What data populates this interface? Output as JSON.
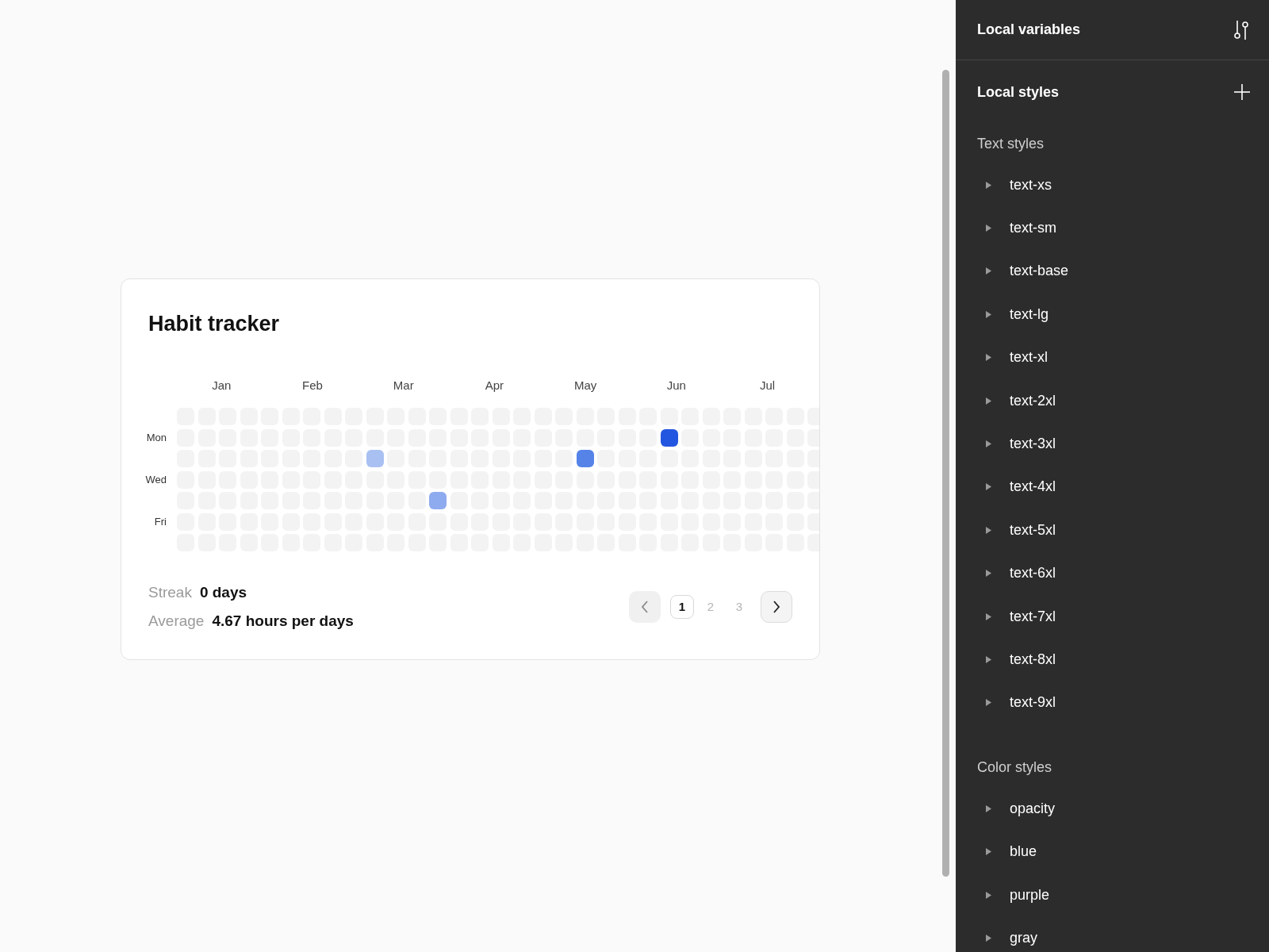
{
  "card": {
    "title": "Habit tracker",
    "months": [
      "Jan",
      "Feb",
      "Mar",
      "Apr",
      "May",
      "Jun",
      "Jul"
    ],
    "rows": [
      {
        "cells": [
          {
            "color": "#f3f3f3"
          },
          {
            "color": "#f3f3f3"
          },
          {
            "color": "#f3f3f3"
          },
          {
            "color": "#f3f3f3"
          },
          {
            "color": "#f3f3f3"
          },
          {
            "color": "#f3f3f3"
          },
          {
            "color": "#f3f3f3"
          },
          {
            "color": "#f3f3f3"
          },
          {
            "color": "#f3f3f3"
          },
          {
            "color": "#f3f3f3"
          },
          {
            "color": "#f3f3f3"
          },
          {
            "color": "#f3f3f3"
          },
          {
            "color": "#f3f3f3"
          },
          {
            "color": "#f3f3f3"
          },
          {
            "color": "#f3f3f3"
          },
          {
            "color": "#f3f3f3"
          },
          {
            "color": "#f3f3f3"
          },
          {
            "color": "#f3f3f3"
          },
          {
            "color": "#f3f3f3"
          },
          {
            "color": "#f3f3f3"
          },
          {
            "color": "#f3f3f3"
          },
          {
            "color": "#f3f3f3"
          },
          {
            "color": "#f3f3f3"
          },
          {
            "color": "#f3f3f3"
          },
          {
            "color": "#f3f3f3"
          },
          {
            "color": "#f3f3f3"
          },
          {
            "color": "#f3f3f3"
          },
          {
            "color": "#f3f3f3"
          },
          {
            "color": "#f3f3f3"
          },
          {
            "color": "#f3f3f3"
          },
          {
            "color": "#f3f3f3"
          }
        ]
      },
      {
        "label": "Mon",
        "cells": [
          {
            "color": "#f3f3f3"
          },
          {
            "color": "#f3f3f3"
          },
          {
            "color": "#f3f3f3"
          },
          {
            "color": "#f3f3f3"
          },
          {
            "color": "#f3f3f3"
          },
          {
            "color": "#f3f3f3"
          },
          {
            "color": "#f3f3f3"
          },
          {
            "color": "#f3f3f3"
          },
          {
            "color": "#f3f3f3"
          },
          {
            "color": "#f3f3f3"
          },
          {
            "color": "#f3f3f3"
          },
          {
            "color": "#f3f3f3"
          },
          {
            "color": "#f3f3f3"
          },
          {
            "color": "#f3f3f3"
          },
          {
            "color": "#f3f3f3"
          },
          {
            "color": "#f3f3f3"
          },
          {
            "color": "#f3f3f3"
          },
          {
            "color": "#f3f3f3"
          },
          {
            "color": "#f3f3f3"
          },
          {
            "color": "#f3f3f3"
          },
          {
            "color": "#f3f3f3"
          },
          {
            "color": "#f3f3f3"
          },
          {
            "color": "#f3f3f3"
          },
          {
            "color": "#2356e0"
          },
          {
            "color": "#f3f3f3"
          },
          {
            "color": "#f3f3f3"
          },
          {
            "color": "#f3f3f3"
          },
          {
            "color": "#f3f3f3"
          },
          {
            "color": "#f3f3f3"
          },
          {
            "color": "#f3f3f3"
          },
          {
            "color": "#f3f3f3"
          }
        ]
      },
      {
        "cells": [
          {
            "color": "#f3f3f3"
          },
          {
            "color": "#f3f3f3"
          },
          {
            "color": "#f3f3f3"
          },
          {
            "color": "#f3f3f3"
          },
          {
            "color": "#f3f3f3"
          },
          {
            "color": "#f3f3f3"
          },
          {
            "color": "#f3f3f3"
          },
          {
            "color": "#f3f3f3"
          },
          {
            "color": "#f3f3f3"
          },
          {
            "color": "#a9c0f2"
          },
          {
            "color": "#f3f3f3"
          },
          {
            "color": "#f3f3f3"
          },
          {
            "color": "#f3f3f3"
          },
          {
            "color": "#f3f3f3"
          },
          {
            "color": "#f3f3f3"
          },
          {
            "color": "#f3f3f3"
          },
          {
            "color": "#f3f3f3"
          },
          {
            "color": "#f3f3f3"
          },
          {
            "color": "#f3f3f3"
          },
          {
            "color": "#5583e8"
          },
          {
            "color": "#f3f3f3"
          },
          {
            "color": "#f3f3f3"
          },
          {
            "color": "#f3f3f3"
          },
          {
            "color": "#f3f3f3"
          },
          {
            "color": "#f3f3f3"
          },
          {
            "color": "#f3f3f3"
          },
          {
            "color": "#f3f3f3"
          },
          {
            "color": "#f3f3f3"
          },
          {
            "color": "#f3f3f3"
          },
          {
            "color": "#f3f3f3"
          },
          {
            "color": "#f3f3f3"
          }
        ]
      },
      {
        "label": "Wed",
        "cells": [
          {
            "color": "#f3f3f3"
          },
          {
            "color": "#f3f3f3"
          },
          {
            "color": "#f3f3f3"
          },
          {
            "color": "#f3f3f3"
          },
          {
            "color": "#f3f3f3"
          },
          {
            "color": "#f3f3f3"
          },
          {
            "color": "#f3f3f3"
          },
          {
            "color": "#f3f3f3"
          },
          {
            "color": "#f3f3f3"
          },
          {
            "color": "#f3f3f3"
          },
          {
            "color": "#f3f3f3"
          },
          {
            "color": "#f3f3f3"
          },
          {
            "color": "#f3f3f3"
          },
          {
            "color": "#f3f3f3"
          },
          {
            "color": "#f3f3f3"
          },
          {
            "color": "#f3f3f3"
          },
          {
            "color": "#f3f3f3"
          },
          {
            "color": "#f3f3f3"
          },
          {
            "color": "#f3f3f3"
          },
          {
            "color": "#f3f3f3"
          },
          {
            "color": "#f3f3f3"
          },
          {
            "color": "#f3f3f3"
          },
          {
            "color": "#f3f3f3"
          },
          {
            "color": "#f3f3f3"
          },
          {
            "color": "#f3f3f3"
          },
          {
            "color": "#f3f3f3"
          },
          {
            "color": "#f3f3f3"
          },
          {
            "color": "#f3f3f3"
          },
          {
            "color": "#f3f3f3"
          },
          {
            "color": "#f3f3f3"
          },
          {
            "color": "#f3f3f3"
          }
        ]
      },
      {
        "cells": [
          {
            "color": "#f3f3f3"
          },
          {
            "color": "#f3f3f3"
          },
          {
            "color": "#f3f3f3"
          },
          {
            "color": "#f3f3f3"
          },
          {
            "color": "#f3f3f3"
          },
          {
            "color": "#f3f3f3"
          },
          {
            "color": "#f3f3f3"
          },
          {
            "color": "#f3f3f3"
          },
          {
            "color": "#f3f3f3"
          },
          {
            "color": "#f3f3f3"
          },
          {
            "color": "#f3f3f3"
          },
          {
            "color": "#f3f3f3"
          },
          {
            "color": "#8fabef"
          },
          {
            "color": "#f3f3f3"
          },
          {
            "color": "#f3f3f3"
          },
          {
            "color": "#f3f3f3"
          },
          {
            "color": "#f3f3f3"
          },
          {
            "color": "#f3f3f3"
          },
          {
            "color": "#f3f3f3"
          },
          {
            "color": "#f3f3f3"
          },
          {
            "color": "#f3f3f3"
          },
          {
            "color": "#f3f3f3"
          },
          {
            "color": "#f3f3f3"
          },
          {
            "color": "#f3f3f3"
          },
          {
            "color": "#f3f3f3"
          },
          {
            "color": "#f3f3f3"
          },
          {
            "color": "#f3f3f3"
          },
          {
            "color": "#f3f3f3"
          },
          {
            "color": "#f3f3f3"
          },
          {
            "color": "#f3f3f3"
          },
          {
            "color": "#f3f3f3"
          }
        ]
      },
      {
        "label": "Fri",
        "cells": [
          {
            "color": "#f3f3f3"
          },
          {
            "color": "#f3f3f3"
          },
          {
            "color": "#f3f3f3"
          },
          {
            "color": "#f3f3f3"
          },
          {
            "color": "#f3f3f3"
          },
          {
            "color": "#f3f3f3"
          },
          {
            "color": "#f3f3f3"
          },
          {
            "color": "#f3f3f3"
          },
          {
            "color": "#f3f3f3"
          },
          {
            "color": "#f3f3f3"
          },
          {
            "color": "#f3f3f3"
          },
          {
            "color": "#f3f3f3"
          },
          {
            "color": "#f3f3f3"
          },
          {
            "color": "#f3f3f3"
          },
          {
            "color": "#f3f3f3"
          },
          {
            "color": "#f3f3f3"
          },
          {
            "color": "#f3f3f3"
          },
          {
            "color": "#f3f3f3"
          },
          {
            "color": "#f3f3f3"
          },
          {
            "color": "#f3f3f3"
          },
          {
            "color": "#f3f3f3"
          },
          {
            "color": "#f3f3f3"
          },
          {
            "color": "#f3f3f3"
          },
          {
            "color": "#f3f3f3"
          },
          {
            "color": "#f3f3f3"
          },
          {
            "color": "#f3f3f3"
          },
          {
            "color": "#f3f3f3"
          },
          {
            "color": "#f3f3f3"
          },
          {
            "color": "#f3f3f3"
          },
          {
            "color": "#f3f3f3"
          },
          {
            "color": "#f3f3f3"
          }
        ]
      },
      {
        "cells": [
          {
            "color": "#f3f3f3"
          },
          {
            "color": "#f3f3f3"
          },
          {
            "color": "#f3f3f3"
          },
          {
            "color": "#f3f3f3"
          },
          {
            "color": "#f3f3f3"
          },
          {
            "color": "#f3f3f3"
          },
          {
            "color": "#f3f3f3"
          },
          {
            "color": "#f3f3f3"
          },
          {
            "color": "#f3f3f3"
          },
          {
            "color": "#f3f3f3"
          },
          {
            "color": "#f3f3f3"
          },
          {
            "color": "#f3f3f3"
          },
          {
            "color": "#f3f3f3"
          },
          {
            "color": "#f3f3f3"
          },
          {
            "color": "#f3f3f3"
          },
          {
            "color": "#f3f3f3"
          },
          {
            "color": "#f3f3f3"
          },
          {
            "color": "#f3f3f3"
          },
          {
            "color": "#f3f3f3"
          },
          {
            "color": "#f3f3f3"
          },
          {
            "color": "#f3f3f3"
          },
          {
            "color": "#f3f3f3"
          },
          {
            "color": "#f3f3f3"
          },
          {
            "color": "#f3f3f3"
          },
          {
            "color": "#f3f3f3"
          },
          {
            "color": "#f3f3f3"
          },
          {
            "color": "#f3f3f3"
          },
          {
            "color": "#f3f3f3"
          },
          {
            "color": "#f3f3f3"
          },
          {
            "color": "#f3f3f3"
          },
          {
            "color": "#f3f3f3"
          }
        ]
      }
    ],
    "stats": [
      {
        "label": "Streak",
        "value": "0 days"
      },
      {
        "label": "Average",
        "value": "4.67 hours per days"
      }
    ],
    "pagination": {
      "prev": {
        "disabled": true
      },
      "next": {
        "disabled": false
      },
      "pages": [
        {
          "label": "1",
          "selected": true
        },
        {
          "label": "2",
          "selected": false
        },
        {
          "label": "3",
          "selected": false
        }
      ]
    }
  },
  "panel": {
    "variables_title": "Local variables",
    "styles_title": "Local styles",
    "groups": [
      {
        "title": "Text styles",
        "items": [
          {
            "label": "text-xs",
            "expanded": false
          },
          {
            "label": "text-sm",
            "expanded": false
          },
          {
            "label": "text-base",
            "expanded": false
          },
          {
            "label": "text-lg",
            "expanded": false
          },
          {
            "label": "text-xl",
            "expanded": false
          },
          {
            "label": "text-2xl",
            "expanded": false
          },
          {
            "label": "text-3xl",
            "expanded": false
          },
          {
            "label": "text-4xl",
            "expanded": false
          },
          {
            "label": "text-5xl",
            "expanded": false
          },
          {
            "label": "text-6xl",
            "expanded": false
          },
          {
            "label": "text-7xl",
            "expanded": false
          },
          {
            "label": "text-8xl",
            "expanded": false
          },
          {
            "label": "text-9xl",
            "expanded": false
          }
        ]
      },
      {
        "title": "Color styles",
        "items": [
          {
            "label": "opacity",
            "expanded": false
          },
          {
            "label": "blue",
            "expanded": false
          },
          {
            "label": "purple",
            "expanded": false
          },
          {
            "label": "gray",
            "expanded": false
          }
        ]
      }
    ]
  }
}
